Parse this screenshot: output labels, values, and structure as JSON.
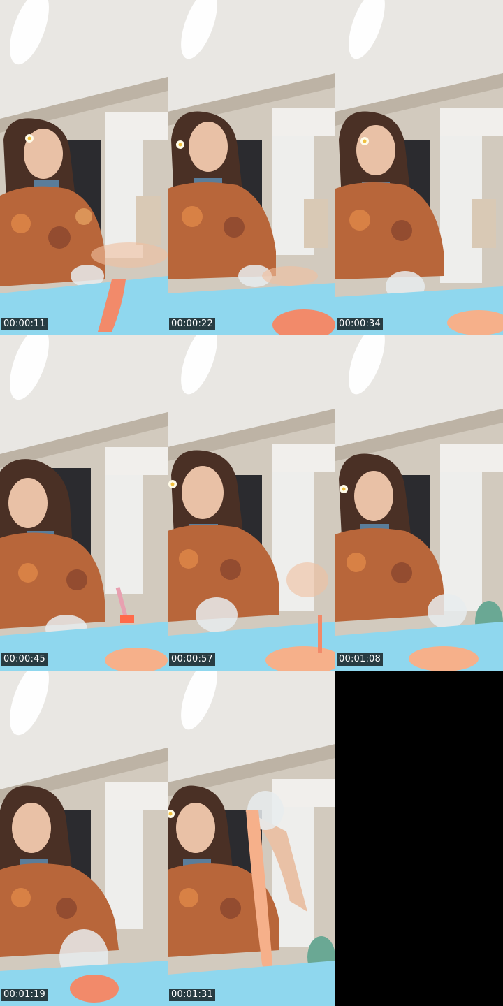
{
  "timestamps": [
    "00:00:11",
    "00:00:22",
    "00:00:34",
    "00:00:45",
    "00:00:57",
    "00:01:08",
    "00:01:19",
    "00:01:31"
  ],
  "colors": {
    "ceiling": "#e8e6e2",
    "wall": "#cfc6b8",
    "table": "#8fd7ee",
    "slime": "#f28a6a",
    "hair": "#4a3025",
    "shirt": "#b8663a",
    "skin": "#e9c1a6"
  }
}
